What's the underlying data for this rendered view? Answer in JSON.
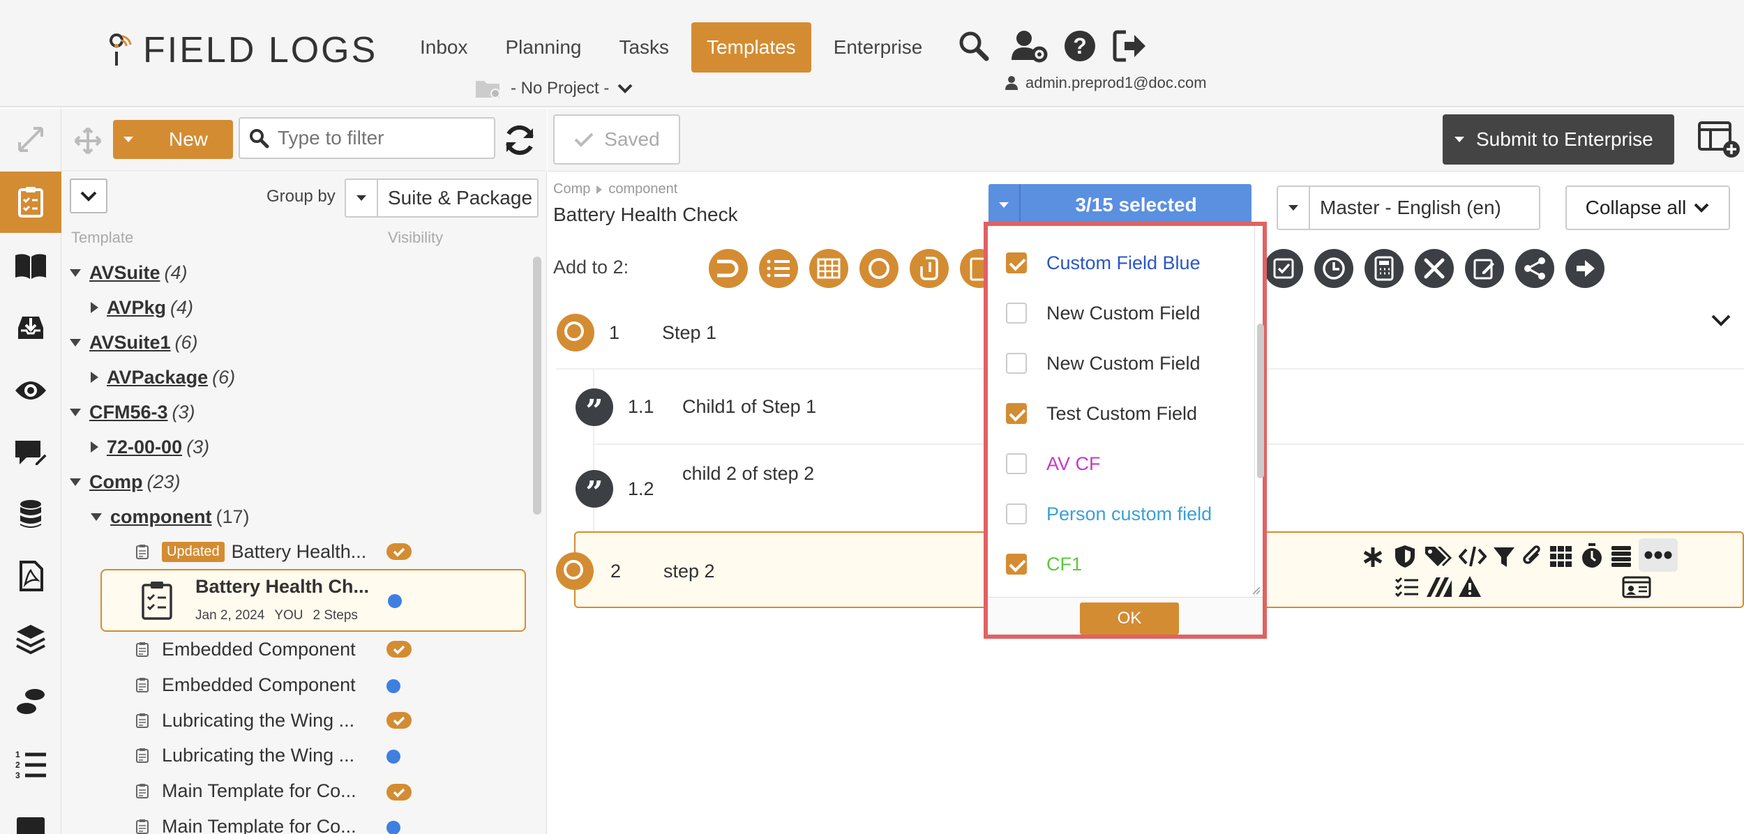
{
  "header": {
    "brand": "FIELD LOGS",
    "nav": [
      {
        "label": "Inbox",
        "active": false
      },
      {
        "label": "Planning",
        "active": false
      },
      {
        "label": "Tasks",
        "active": false
      },
      {
        "label": "Templates",
        "active": true
      },
      {
        "label": "Enterprise",
        "active": false
      }
    ],
    "project": "- No Project -",
    "user_email": "admin.preprod1@doc.com"
  },
  "left_toolbar": {
    "new_label": "New",
    "filter_placeholder": "Type to filter"
  },
  "tree": {
    "group_by_label": "Group by",
    "group_by_value": "Suite & Package",
    "col_template": "Template",
    "col_visibility": "Visibility",
    "nodes": [
      {
        "name": "AVSuite",
        "count": "(4)"
      },
      {
        "name": "AVPkg",
        "count": "(4)"
      },
      {
        "name": "AVSuite1",
        "count": "(6)"
      },
      {
        "name": "AVPackage",
        "count": "(6)"
      },
      {
        "name": "CFM56-3",
        "count": "(3)"
      },
      {
        "name": "72-00-00",
        "count": "(3)"
      },
      {
        "name": "Comp",
        "count": "(23)"
      },
      {
        "name": "component",
        "count": "(17)"
      }
    ],
    "updated_tag": "Updated",
    "leaves": [
      "Battery Health...",
      "Embedded Component",
      "Embedded Component",
      "Lubricating the Wing ...",
      "Lubricating the Wing ...",
      "Main Template for Co...",
      "Main Template for Co..."
    ],
    "selected": {
      "title": "Battery Health Ch...",
      "date": "Jan 2, 2024",
      "owner": "YOU",
      "steps": "2 Steps"
    }
  },
  "main_toolbar": {
    "saved_label": "Saved",
    "submit_label": "Submit to Enterprise"
  },
  "template": {
    "breadcrumb": [
      "Comp",
      "component"
    ],
    "title": "Battery Health Check",
    "language": "Master - English (en)",
    "collapse_label": "Collapse all",
    "add_to_label": "Add to 2:",
    "steps": [
      {
        "num": "1",
        "text": "Step 1"
      },
      {
        "num": "1.1",
        "text": "Child1 of Step 1"
      },
      {
        "num": "1.2",
        "text": "child 2 of step 2"
      },
      {
        "num": "2",
        "text": "step 2"
      }
    ]
  },
  "custom_fields_dropdown": {
    "summary": "3/15 selected",
    "ok_label": "OK",
    "items": [
      {
        "label": "Custom Field Blue",
        "checked": true,
        "color": "#2a56c6"
      },
      {
        "label": "New Custom Field",
        "checked": false,
        "color": "#333333"
      },
      {
        "label": "New Custom Field",
        "checked": false,
        "color": "#333333"
      },
      {
        "label": "Test Custom Field",
        "checked": true,
        "color": "#333333"
      },
      {
        "label": "AV CF",
        "checked": false,
        "color": "#c838c8"
      },
      {
        "label": "Person custom field",
        "checked": false,
        "color": "#3aa0d8"
      },
      {
        "label": "CF1",
        "checked": true,
        "color": "#5cc83c"
      }
    ]
  },
  "colors": {
    "accent": "#d48c32",
    "dark": "#3c4044",
    "select_blue": "#5b8fe0",
    "highlight_red": "#e06262",
    "dot_blue": "#3f7fe0"
  }
}
